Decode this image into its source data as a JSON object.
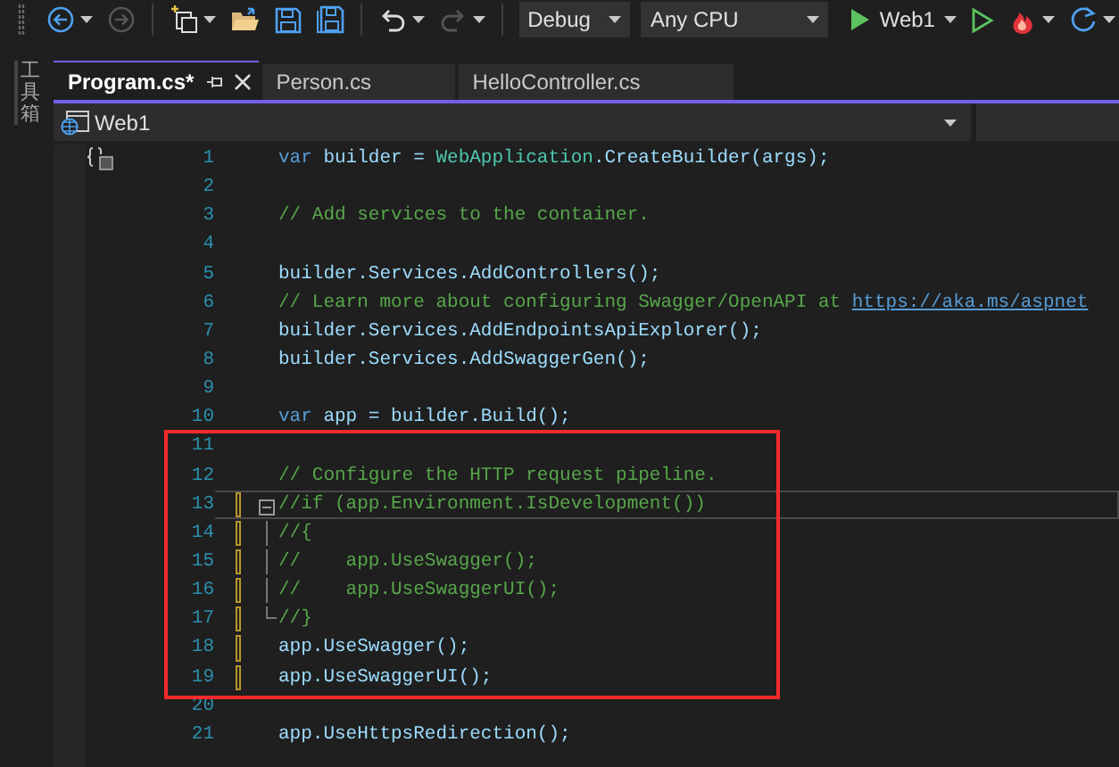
{
  "toolbar": {
    "items": [
      {
        "kind": "back",
        "disabled": false,
        "caret": true
      },
      {
        "kind": "forward",
        "disabled": true,
        "caret": false
      },
      {
        "kind": "separator"
      },
      {
        "kind": "new-item",
        "disabled": false,
        "caret": true
      },
      {
        "kind": "open",
        "disabled": false,
        "caret": false
      },
      {
        "kind": "save",
        "disabled": false,
        "caret": false
      },
      {
        "kind": "save-all",
        "disabled": false,
        "caret": false
      },
      {
        "kind": "separator"
      },
      {
        "kind": "undo",
        "disabled": false,
        "caret": true
      },
      {
        "kind": "redo",
        "disabled": true,
        "caret": true
      },
      {
        "kind": "separator"
      },
      {
        "kind": "dropdown",
        "label": "Debug"
      },
      {
        "kind": "dropdown",
        "label": "Any CPU"
      },
      {
        "kind": "run",
        "label": "Web1",
        "disabled": false,
        "caret": true
      },
      {
        "kind": "run-outline",
        "disabled": false,
        "caret": false
      },
      {
        "kind": "hot-reload",
        "disabled": false,
        "caret": true
      },
      {
        "kind": "refresh",
        "disabled": false,
        "caret": true
      }
    ]
  },
  "side_panel": {
    "label": "工具箱"
  },
  "tabs": [
    {
      "label": "Program.cs*",
      "selected": true,
      "pinnable": true
    },
    {
      "label": "Person.cs",
      "selected": false,
      "pinnable": false
    },
    {
      "label": "HelloController.cs",
      "selected": false,
      "pinnable": false
    }
  ],
  "navigation_bar": {
    "project": "Web1"
  },
  "editor": {
    "lines": [
      {
        "number": "1",
        "tokens": [
          {
            "text": "var",
            "kind": "keyword"
          },
          {
            "text": " builder = ",
            "kind": "ident"
          },
          {
            "text": "WebApplication",
            "kind": "type"
          },
          {
            "text": ".CreateBuilder(",
            "kind": "ident"
          },
          {
            "text": "args",
            "kind": "param"
          },
          {
            "text": ");",
            "kind": "ident"
          }
        ]
      },
      {
        "number": "2"
      },
      {
        "number": "3",
        "tokens": [
          {
            "text": "// Add services to the container.",
            "kind": "comment"
          }
        ]
      },
      {
        "number": "4"
      },
      {
        "number": "5",
        "tokens": [
          {
            "text": "builder.Services.AddControllers();",
            "kind": "ident"
          }
        ]
      },
      {
        "number": "6",
        "tokens": [
          {
            "text": "// Learn more about configuring Swagger/OpenAPI at ",
            "kind": "comment"
          },
          {
            "text": "https://aka.ms/aspnet",
            "kind": "link"
          }
        ]
      },
      {
        "number": "7",
        "tokens": [
          {
            "text": "builder.Services.AddEndpointsApiExplorer();",
            "kind": "ident"
          }
        ]
      },
      {
        "number": "8",
        "tokens": [
          {
            "text": "builder.Services.AddSwaggerGen();",
            "kind": "ident"
          }
        ]
      },
      {
        "number": "9"
      },
      {
        "number": "10",
        "tokens": [
          {
            "text": "var",
            "kind": "keyword"
          },
          {
            "text": " app = builder.Build();",
            "kind": "ident"
          }
        ]
      },
      {
        "number": "11"
      },
      {
        "number": "12",
        "tokens": [
          {
            "text": "// Configure the HTTP request pipeline.",
            "kind": "comment"
          }
        ]
      },
      {
        "number": "13",
        "changed": true,
        "current": true,
        "fold_start": true,
        "tokens": [
          {
            "text": "//if (app.Environment.IsDevelopment())",
            "kind": "comment"
          }
        ]
      },
      {
        "number": "14",
        "changed": true,
        "in_fold": true,
        "tokens": [
          {
            "text": "//{",
            "kind": "comment"
          }
        ]
      },
      {
        "number": "15",
        "changed": true,
        "in_fold": true,
        "tokens": [
          {
            "text": "//    app.UseSwagger();",
            "kind": "comment"
          }
        ]
      },
      {
        "number": "16",
        "changed": true,
        "in_fold": true,
        "tokens": [
          {
            "text": "//    app.UseSwaggerUI();",
            "kind": "comment"
          }
        ]
      },
      {
        "number": "17",
        "changed": true,
        "in_fold": true,
        "tokens": [
          {
            "text": "//}",
            "kind": "comment"
          }
        ]
      },
      {
        "number": "18",
        "changed": true,
        "tokens": [
          {
            "text": "app.UseSwagger();",
            "kind": "ident"
          }
        ]
      },
      {
        "number": "19",
        "changed": true,
        "tokens": [
          {
            "text": "app.UseSwaggerUI();",
            "kind": "ident"
          }
        ]
      },
      {
        "number": "20"
      },
      {
        "number": "21",
        "tokens": [
          {
            "text": "app.UseHttpsRedirection();",
            "kind": "ident"
          }
        ]
      }
    ]
  }
}
